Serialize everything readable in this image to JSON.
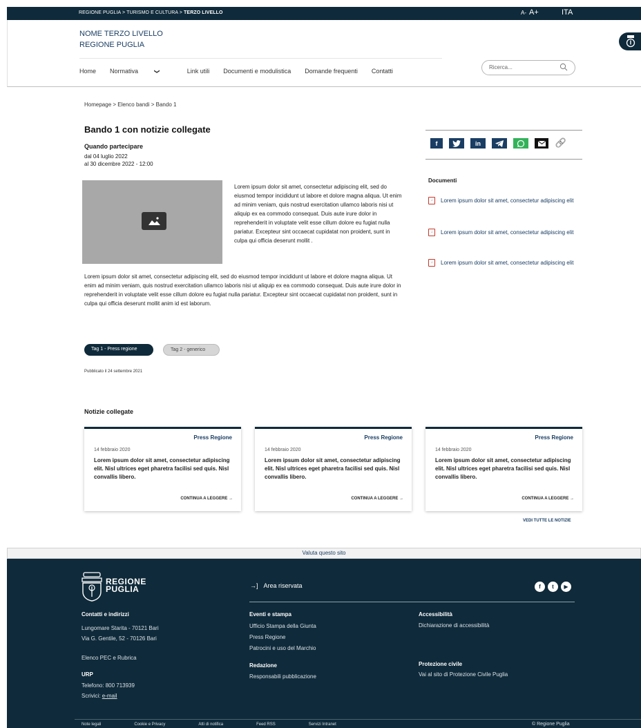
{
  "topbar": {
    "breadcrumb_pre": "REGIONE PUGLIA > TURISMO E CULTURA > ",
    "breadcrumb_current": "TERZO LIVELLO",
    "font_small": "A-",
    "font_large": "A+",
    "language": "ITA"
  },
  "header": {
    "site_name_1": "NOME TERZO LIVELLO",
    "site_name_2": "REGIONE PUGLIA",
    "nav": [
      "Home",
      "Normativa",
      "Link utili",
      "Documenti e modulistica",
      "Domande frequenti",
      "Contatti"
    ],
    "search_placeholder": "Ricerca..."
  },
  "main": {
    "breadcrumb": "Homepage  >  Elenco bandi > Bando 1",
    "title": "Bando 1 con notizie collegate",
    "when_label": "Quando partecipare",
    "when_from": "dal 04 luglio 2022",
    "when_to": "al 30 dicembre 2022 - 12:00",
    "paragraph_right": "Lorem ipsum dolor sit amet, consectetur adipiscing elit, sed do eiusmod tempor incididunt ut labore et dolore magna aliqua. Ut enim ad minim veniam, quis nostrud exercitation ullamco laboris nisi ut aliquip ex ea commodo consequat. Duis aute irure dolor in reprehenderit in voluptate velit esse cillum dolore eu fugiat nulla pariatur. Excepteur sint occaecat cupidatat non proident, sunt in culpa qui officia deserunt mollit .",
    "paragraph_full": "Lorem ipsum dolor sit amet, consectetur adipiscing elit, sed do eiusmod tempor incididunt ut labore et dolore magna aliqua. Ut enim ad minim veniam, quis nostrud exercitation ullamco laboris nisi ut aliquip ex ea commodo consequat. Duis aute irure dolor in reprehenderit in voluptate velit esse cillum dolore eu fugiat nulla pariatur. Excepteur sint occaecat cupidatat non proident, sunt in culpa qui officia deserunt mollit anim id est laborum.",
    "tag_1": "Tag 1 - Press regione",
    "tag_2": "Tag 2 - generico",
    "published": "Pubblicato il 24 settembre 2021"
  },
  "share": {
    "icons": [
      "facebook-icon",
      "twitter-icon",
      "linkedin-icon",
      "telegram-icon",
      "whatsapp-icon",
      "email-icon",
      "link-icon"
    ]
  },
  "documents": {
    "title": "Documenti",
    "items": [
      "Lorem ipsum dolor sit amet, consectetur adipiscing elit",
      "Lorem ipsum dolor sit amet, consectetur adipiscing elit",
      "Lorem ipsum dolor sit amet, consectetur adipiscing elit"
    ]
  },
  "news": {
    "title": "Notizie collegate",
    "cards": [
      {
        "category": "Press Regione",
        "date": "14 febbraio 2020",
        "text": "Lorem ipsum dolor sit amet, consectetur adipiscing elit. Nisl ultrices eget pharetra facilisi sed quis. Nisl convallis libero.",
        "more": "CONTINUA A LEGGERE  →"
      },
      {
        "category": "Press Regione",
        "date": "14 febbraio 2020",
        "text": "Lorem ipsum dolor sit amet, consectetur adipiscing elit. Nisl ultrices eget pharetra facilisi sed quis. Nisl convallis libero.",
        "more": "CONTINUA A LEGGERE  →"
      },
      {
        "category": "Press Regione",
        "date": "14 febbraio 2020",
        "text": "Lorem ipsum dolor sit amet, consectetur adipiscing elit. Nisl ultrices eget pharetra facilisi sed quis. Nisl convallis libero.",
        "more": "CONTINUA A LEGGERE  →"
      }
    ],
    "see_all": "VEDI TUTTE LE NOTIZIE"
  },
  "footer": {
    "rate": "Valuta questo sito",
    "logo_line_1": "REGIONE",
    "logo_line_2": "PUGLIA",
    "area_riservata": "Area riservata",
    "contacts_title": "Contatti e indirizzi",
    "address_1": "Lungomare Starita - 70121 Bari",
    "address_2": "Via G. Gentile, 52 - 70126 Bari",
    "pec": "Elenco PEC e Rubrica",
    "urp_title": "URP",
    "urp_phone": "Telefono: 800 713939",
    "urp_write_pre": "Scrivici: ",
    "urp_email": "e-mail",
    "events_title": "Eventi e stampa",
    "events": [
      "Ufficio Stampa della Giunta",
      "Press Regione",
      "Patrocini e uso del Marchio"
    ],
    "redazione_title": "Redazione",
    "redazione": "Responsabili pubblicazione",
    "access_title": "Accessibilità",
    "access": "Dichiarazione di accessibilità",
    "civil_title": "Protezione civile",
    "civil": "Vai al sito di Protezione Civile Puglia",
    "bottom_links": [
      "Note legali",
      "Cookie e Privacy",
      "Atti di notifica",
      "Feed RSS",
      "Servizi Intranet"
    ],
    "copyright": "© Regione Puglia"
  },
  "colors": {
    "primary_dark": "#0f2a3a",
    "link_blue": "#1a3d63",
    "pdf_red": "#c0392b",
    "whatsapp_green": "#34b25a"
  }
}
